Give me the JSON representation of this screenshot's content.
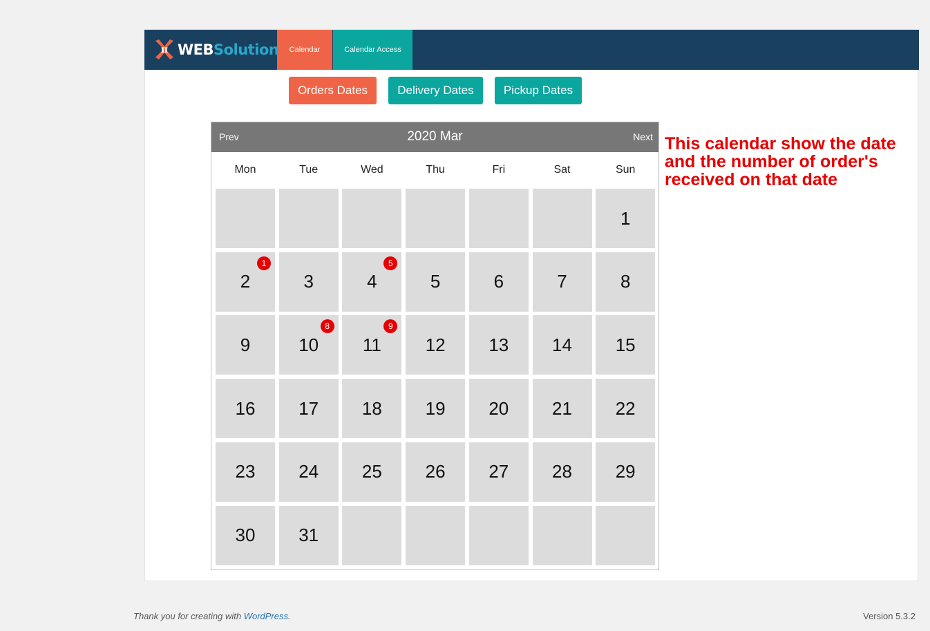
{
  "brand": {
    "logo_word1": "WEB",
    "logo_word2": "Solution"
  },
  "nav": {
    "tabs": [
      "Calendar",
      "Calendar Access"
    ]
  },
  "buttons": {
    "orders": "Orders Dates",
    "delivery": "Delivery Dates",
    "pickup": "Pickup Dates"
  },
  "calendar": {
    "prev": "Prev",
    "next": "Next",
    "title": "2020 Mar",
    "weekdays": [
      "Mon",
      "Tue",
      "Wed",
      "Thu",
      "Fri",
      "Sat",
      "Sun"
    ],
    "leading_blank_days": 6,
    "days_in_month": 31,
    "order_counts": {
      "2": 1,
      "4": 5,
      "10": 8,
      "11": 9
    }
  },
  "note": "This calendar show the date and the number of order's received on that date",
  "footer": {
    "thanks_prefix": "Thank you for creating with ",
    "thanks_link": "WordPress",
    "thanks_suffix": ".",
    "version": "Version 5.3.2"
  },
  "colors": {
    "topbar": "#1a4060",
    "orange": "#ef6446",
    "teal": "#0ba69e",
    "badge": "#e60000",
    "cell": "#dcdcdc"
  }
}
